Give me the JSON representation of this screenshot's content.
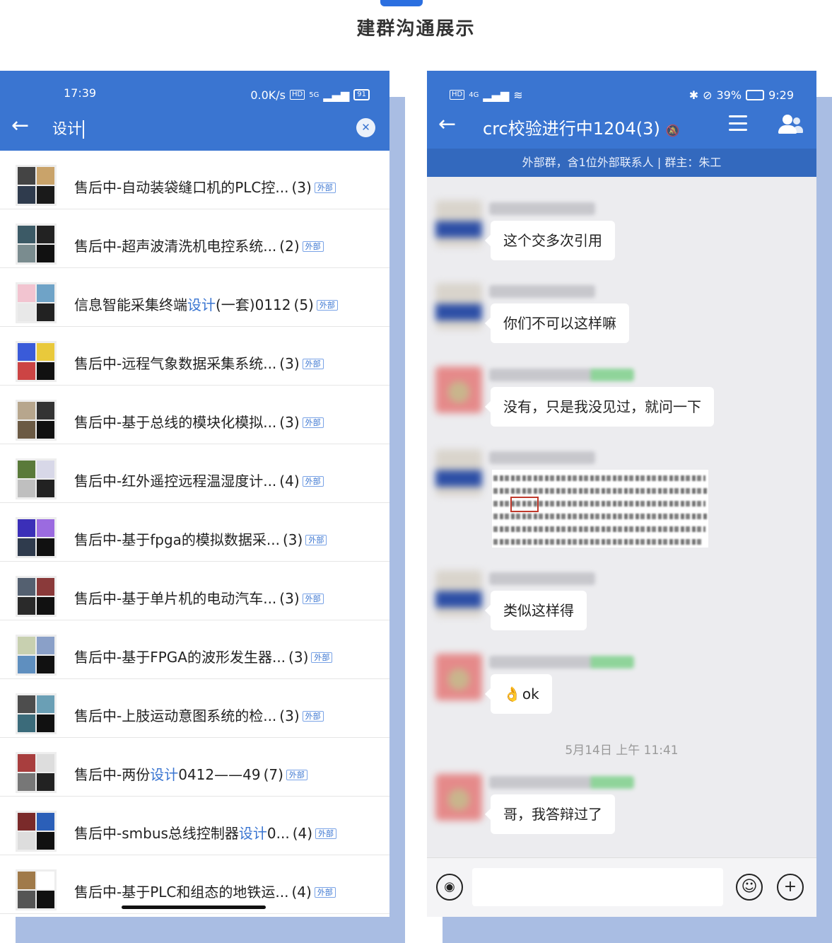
{
  "page": {
    "title": "建群沟通展示"
  },
  "left_phone": {
    "status": {
      "time": "17:39",
      "net_speed": "0.0K/s",
      "hd": "HD",
      "signal": "5G",
      "battery": "91"
    },
    "search": {
      "query": "设计"
    },
    "groups": [
      {
        "name": "售后中-自动装袋缝口机的PLC控...",
        "name_hl": "",
        "name_post": "",
        "count": "(3)",
        "badge": "外部"
      },
      {
        "name": "售后中-超声波清洗机电控系统...",
        "name_hl": "",
        "name_post": "",
        "count": "(2)",
        "badge": "外部"
      },
      {
        "name": "信息智能采集终端",
        "name_hl": "设计",
        "name_post": "(一套)0112",
        "count": "(5)",
        "badge": "外部"
      },
      {
        "name": "售后中-远程气象数据采集系统...",
        "name_hl": "",
        "name_post": "",
        "count": "(3)",
        "badge": "外部"
      },
      {
        "name": "售后中-基于总线的模块化模拟...",
        "name_hl": "",
        "name_post": "",
        "count": "(3)",
        "badge": "外部"
      },
      {
        "name": "售后中-红外遥控远程温湿度计...",
        "name_hl": "",
        "name_post": "",
        "count": "(4)",
        "badge": "外部"
      },
      {
        "name": "售后中-基于fpga的模拟数据采...",
        "name_hl": "",
        "name_post": "",
        "count": "(3)",
        "badge": "外部"
      },
      {
        "name": "售后中-基于单片机的电动汽车...",
        "name_hl": "",
        "name_post": "",
        "count": "(3)",
        "badge": "外部"
      },
      {
        "name": "售后中-基于FPGA的波形发生器...",
        "name_hl": "",
        "name_post": "",
        "count": "(3)",
        "badge": "外部"
      },
      {
        "name": "售后中-上肢运动意图系统的检...",
        "name_hl": "",
        "name_post": "",
        "count": "(3)",
        "badge": "外部"
      },
      {
        "name": "售后中-两份",
        "name_hl": "设计",
        "name_post": "0412——49",
        "count": "(7)",
        "badge": "外部"
      },
      {
        "name": "售后中-smbus总线控制器",
        "name_hl": "设计",
        "name_post": "0...",
        "count": "(4)",
        "badge": "外部"
      },
      {
        "name": "售后中-基于PLC和组态的地铁运...",
        "name_hl": "",
        "name_post": "",
        "count": "(4)",
        "badge": "外部"
      }
    ]
  },
  "right_phone": {
    "status": {
      "hd": "HD",
      "signal": "4G",
      "battery_pct": "39%",
      "time": "9:29"
    },
    "chat": {
      "title": "crc校验进行中1204(3)",
      "subtitle": "外部群，含1位外部联系人 | 群主：朱工"
    },
    "messages": [
      {
        "text": "这个交多次引用"
      },
      {
        "text": "你们不可以这样嘛"
      },
      {
        "text": "没有，只是我没见过，就问一下"
      },
      {
        "text": "类似这样得"
      },
      {
        "emoji": "👌",
        "text": "ok"
      },
      {
        "text": "哥，我答辩过了"
      }
    ],
    "timestamp": "5月14日  上午 11:41",
    "input": {
      "placeholder": ""
    }
  },
  "colors": {
    "accent": "#3a75d1",
    "header_dark": "#3369be",
    "shadow": "#a9bde3",
    "chat_bg": "#ececef",
    "badge": "#3a75d1"
  },
  "icons": [
    "back-arrow-icon",
    "clear-icon",
    "menu-icon",
    "members-icon",
    "mute-icon",
    "voice-icon",
    "emoji-icon",
    "plus-icon"
  ]
}
